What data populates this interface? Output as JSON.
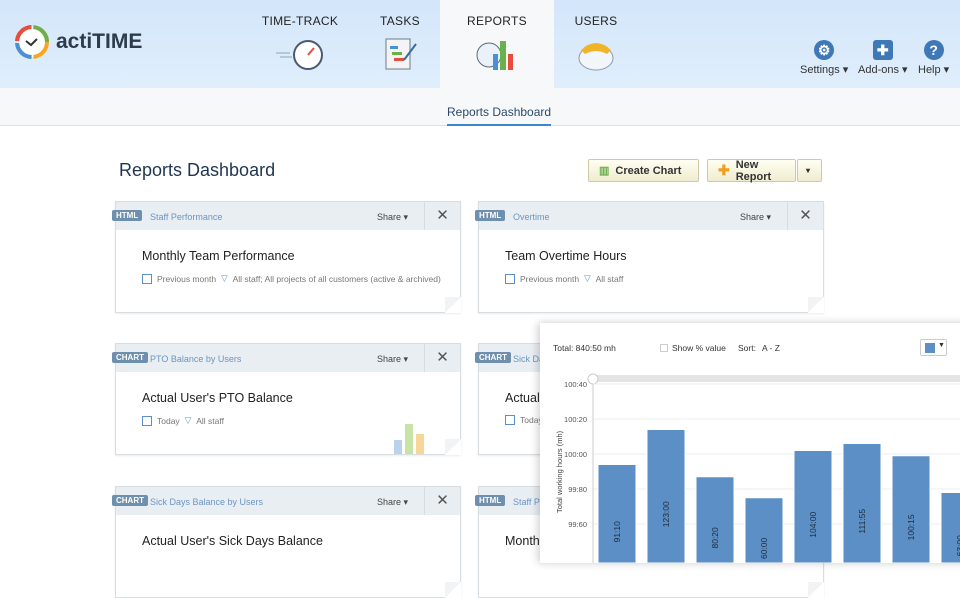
{
  "app": {
    "logo_text": "actiTIME"
  },
  "nav": {
    "tabs": [
      {
        "label": "TIME-TRACK"
      },
      {
        "label": "TASKS"
      },
      {
        "label": "REPORTS",
        "active": true
      },
      {
        "label": "USERS"
      }
    ],
    "utils": [
      {
        "label": "Settings ▾",
        "icon": "gear-icon"
      },
      {
        "label": "Add-ons ▾",
        "icon": "puzzle-icon"
      },
      {
        "label": "Help ▾",
        "icon": "help-icon"
      }
    ]
  },
  "subnav": {
    "active": "Reports Dashboard"
  },
  "page": {
    "title": "Reports Dashboard",
    "create_chart": "Create Chart",
    "new_report": "New Report"
  },
  "cards": [
    {
      "type": "HTML",
      "category": "Staff Performance",
      "title": "Monthly Team Performance",
      "period": "Previous month",
      "filter": "All staff; All projects of all customers (active & archived)",
      "share": "Share ▾"
    },
    {
      "type": "HTML",
      "category": "Overtime",
      "title": "Team Overtime Hours",
      "period": "Previous month",
      "filter": "All staff",
      "share": "Share ▾"
    },
    {
      "type": "CHART",
      "category": "PTO Balance by Users",
      "title": "Actual User's PTO Balance",
      "period": "Today",
      "filter": "All staff",
      "share": "Share ▾"
    },
    {
      "type": "CHART",
      "category": "Sick Da",
      "title": "Actual",
      "period": "Today",
      "filter": "",
      "share": ""
    },
    {
      "type": "CHART",
      "category": "Sick Days Balance by Users",
      "title": "Actual User's Sick Days Balance",
      "period": "",
      "filter": "",
      "share": "Share ▾"
    },
    {
      "type": "HTML",
      "category": "Staff Pe",
      "title": "Monthl",
      "period": "",
      "filter": "",
      "share": ""
    }
  ],
  "panel": {
    "total": "Total: 840:50 mh",
    "show_pct": "Show % value",
    "sort_label": "Sort:",
    "sort_value": "A - Z",
    "color": "#5b8fc6"
  },
  "chart_data": {
    "type": "bar",
    "ylabel": "Total working hours (mh)",
    "yticks": [
      "100:40",
      "100:20",
      "100:00",
      "99:80",
      "99:60"
    ],
    "ytick_values": [
      100.4,
      100.2,
      100.0,
      99.8,
      99.6
    ],
    "ylim": [
      99.5,
      100.4
    ],
    "labels": [
      "91:10",
      "123:00",
      "80:20",
      "60:00",
      "104:00",
      "111:55",
      "100:15",
      "63:00"
    ],
    "values": [
      99.94,
      100.14,
      99.87,
      99.75,
      100.02,
      100.06,
      99.99,
      99.78
    ]
  }
}
